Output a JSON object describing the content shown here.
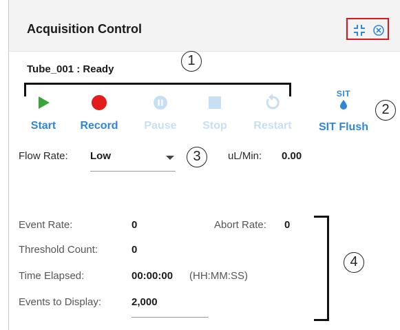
{
  "panel": {
    "title": "Acquisition Control",
    "status": "Tube_001 : Ready"
  },
  "controls": {
    "start": "Start",
    "record": "Record",
    "pause": "Pause",
    "stop": "Stop",
    "restart": "Restart",
    "sit_flush": "SIT Flush",
    "sit_icon_text": "SIT"
  },
  "flow": {
    "label": "Flow Rate:",
    "value": "Low",
    "rate_label": "uL/Min:",
    "rate_value": "0.00"
  },
  "stats": {
    "event_rate_label": "Event Rate:",
    "event_rate_value": "0",
    "abort_rate_label": "Abort Rate:",
    "abort_rate_value": "0",
    "threshold_label": "Threshold Count:",
    "threshold_value": "0",
    "time_label": "Time Elapsed:",
    "time_value": "00:00:00",
    "time_format": "(HH:MM:SS)",
    "events_display_label": "Events to Display:",
    "events_display_value": "2,000"
  },
  "callouts": [
    "1",
    "2",
    "3",
    "4"
  ],
  "colors": {
    "start": "#3aa33a",
    "record": "#e21b1b",
    "accent": "#2f86d6",
    "disabled": "#c7dff4",
    "highlight_box": "#e0141e"
  }
}
